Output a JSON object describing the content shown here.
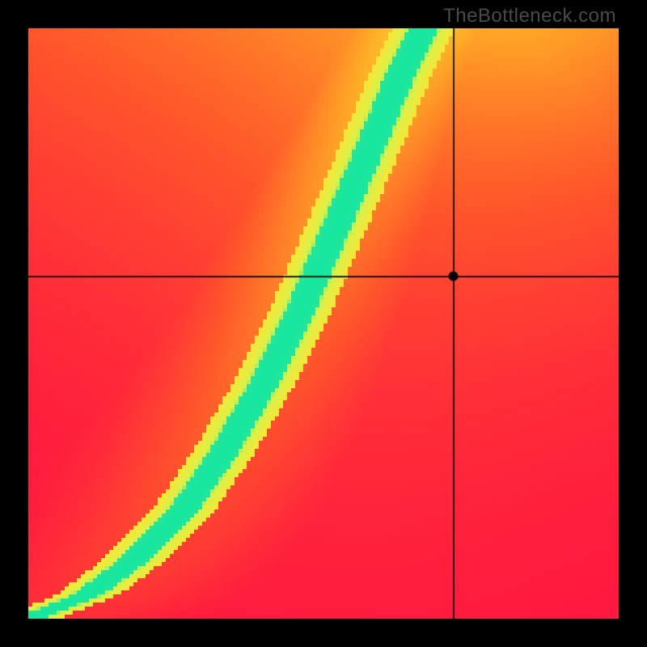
{
  "watermark": "TheBottleneck.com",
  "chart_data": {
    "type": "heatmap",
    "title": "",
    "xlabel": "",
    "ylabel": "",
    "xlim": [
      0,
      1
    ],
    "ylim": [
      0,
      1
    ],
    "crosshair": {
      "x": 0.72,
      "y": 0.58
    },
    "marker": {
      "x": 0.72,
      "y": 0.58
    },
    "gradient_stops": [
      {
        "t": 0.0,
        "color": "#ff1740"
      },
      {
        "t": 0.28,
        "color": "#ff5a2a"
      },
      {
        "t": 0.55,
        "color": "#ffa726"
      },
      {
        "t": 0.78,
        "color": "#ffe433"
      },
      {
        "t": 0.93,
        "color": "#d8f24a"
      },
      {
        "t": 1.0,
        "color": "#17e6a0"
      }
    ],
    "ridge": [
      {
        "x": 0.0,
        "y": 0.0
      },
      {
        "x": 0.1,
        "y": 0.04
      },
      {
        "x": 0.18,
        "y": 0.1
      },
      {
        "x": 0.26,
        "y": 0.18
      },
      {
        "x": 0.33,
        "y": 0.28
      },
      {
        "x": 0.4,
        "y": 0.4
      },
      {
        "x": 0.46,
        "y": 0.52
      },
      {
        "x": 0.52,
        "y": 0.66
      },
      {
        "x": 0.58,
        "y": 0.8
      },
      {
        "x": 0.63,
        "y": 0.92
      },
      {
        "x": 0.67,
        "y": 1.0
      }
    ],
    "ridge_width": 0.045,
    "softness": 0.55,
    "series": [],
    "categories": []
  }
}
